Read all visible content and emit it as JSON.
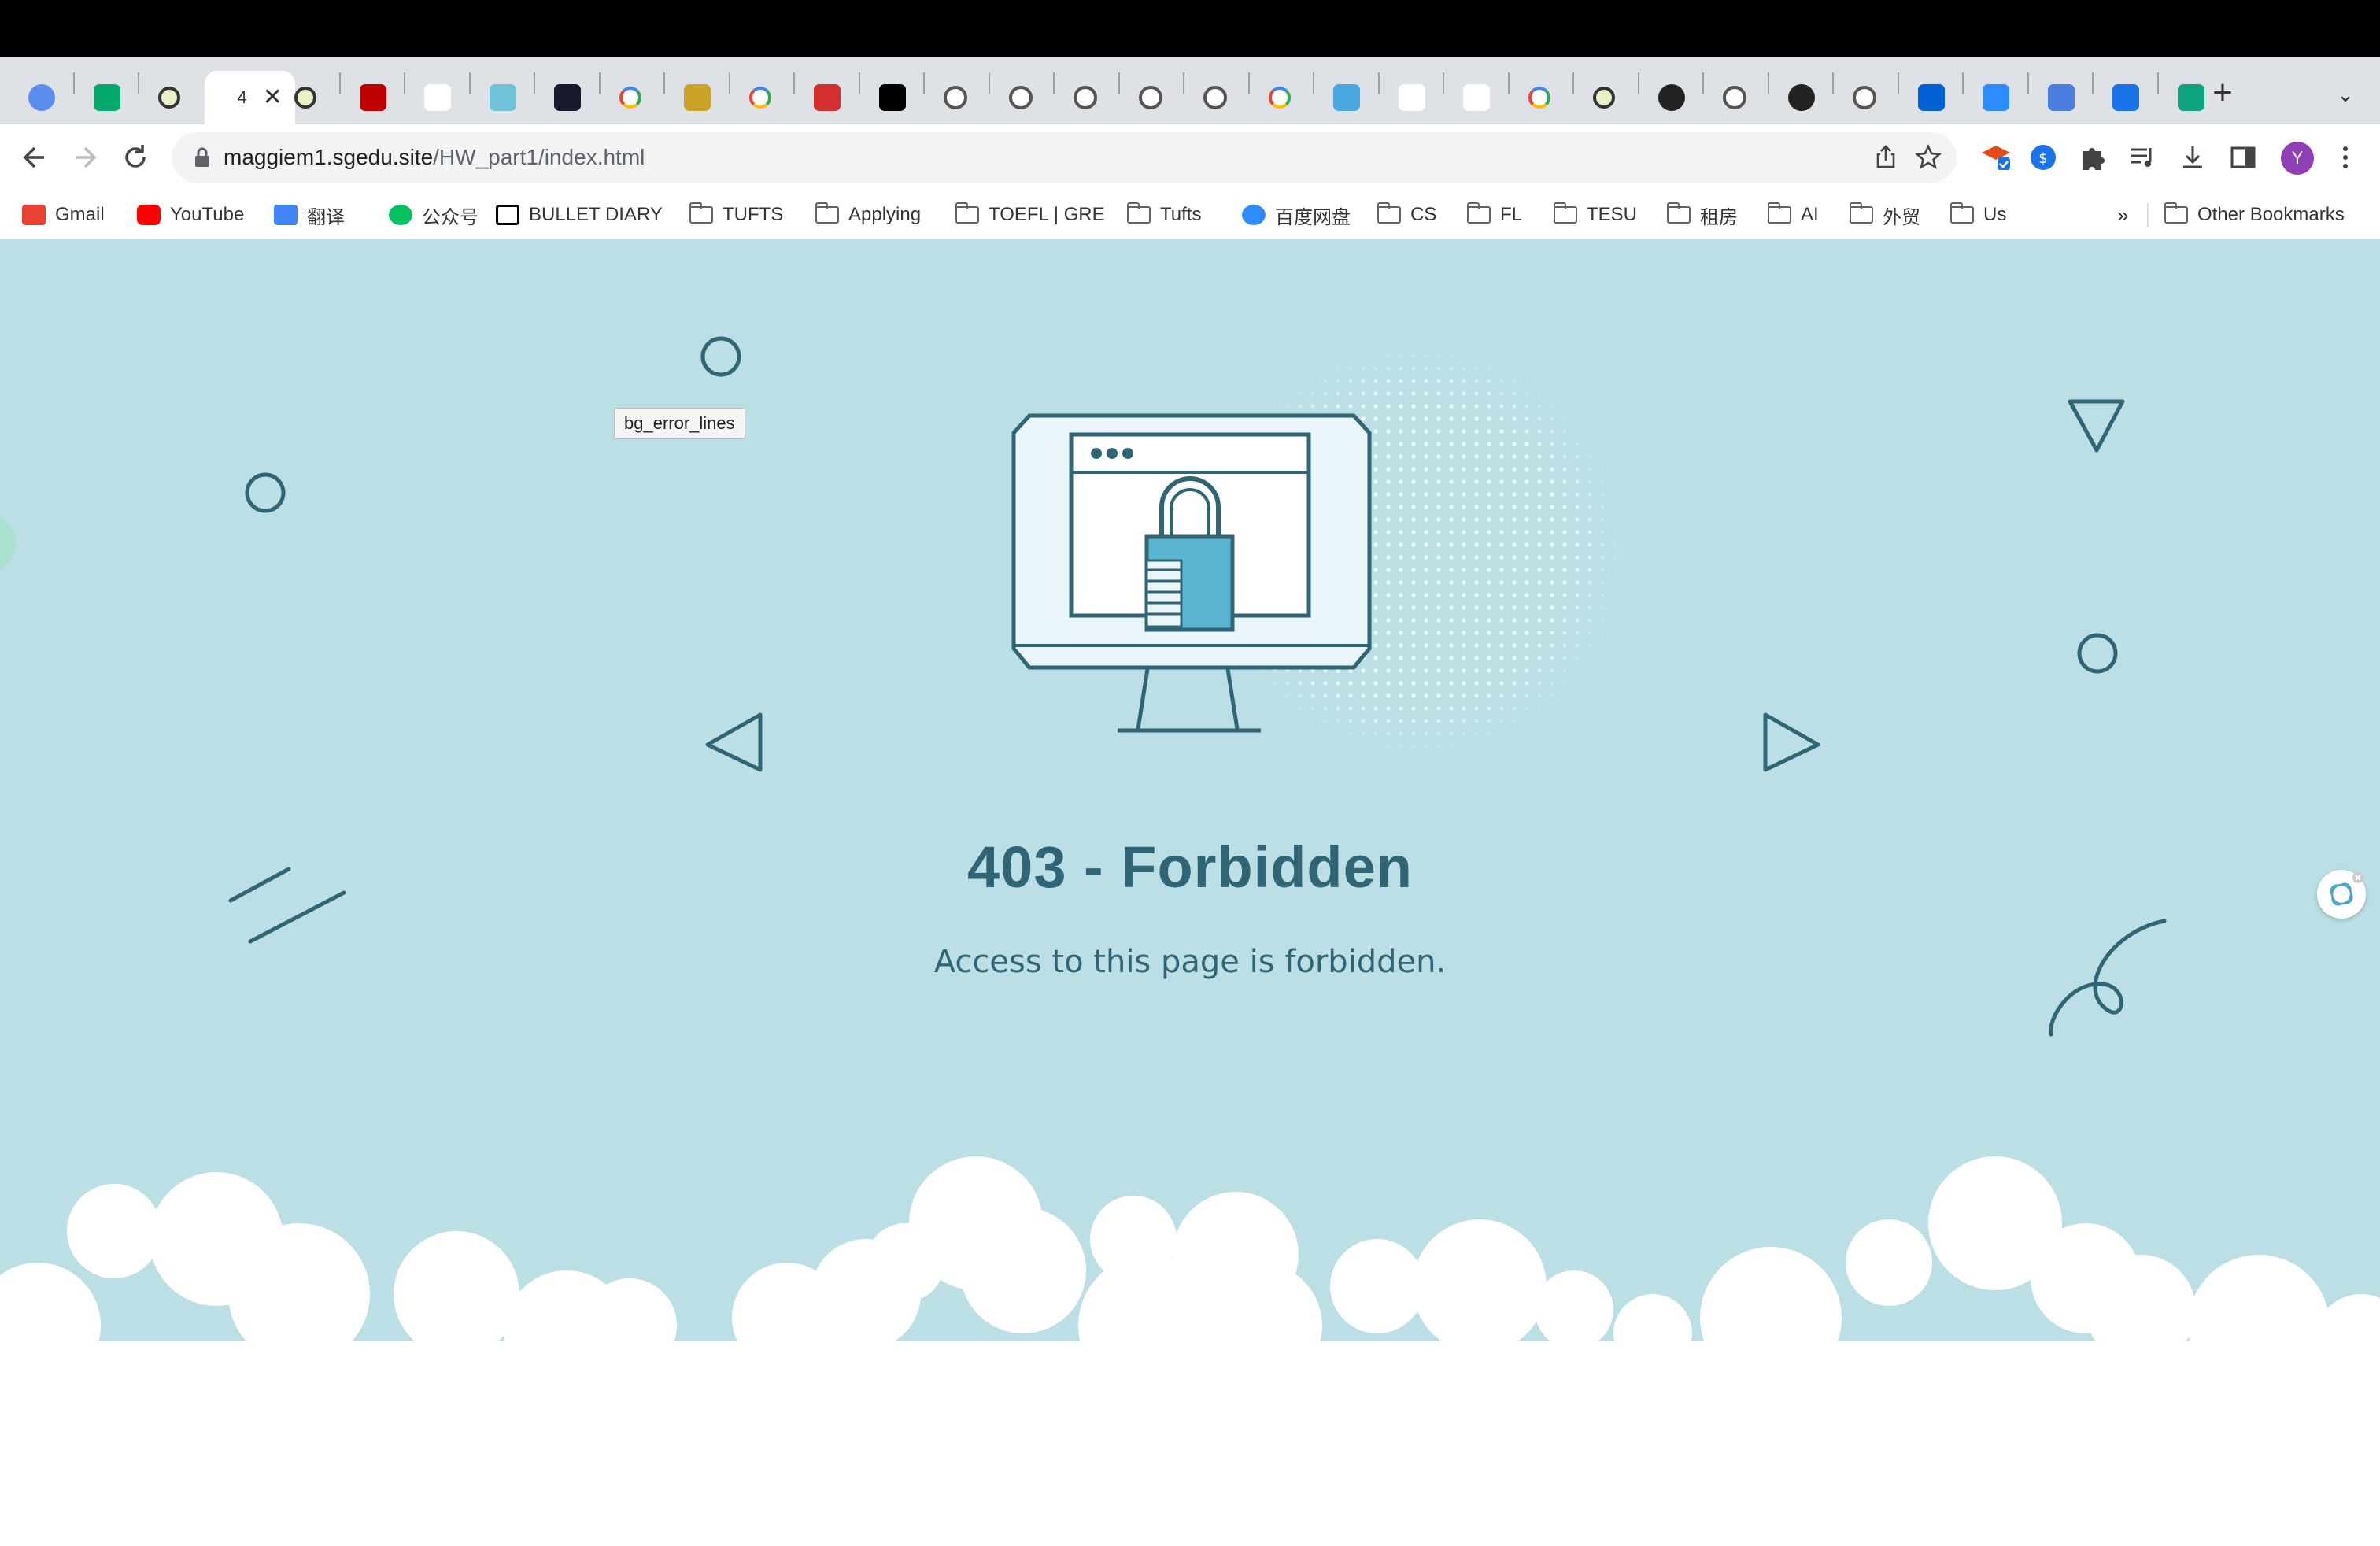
{
  "browser": {
    "tabs": [
      {
        "favicon": "globe-icon",
        "title": "",
        "color": "#5b8def"
      },
      {
        "favicon": "w3-icon",
        "title": "",
        "color": "#04aa6d"
      },
      {
        "favicon": "target-icon",
        "title": "",
        "color": "#e8f0c8"
      },
      {
        "favicon": "page-icon",
        "title": "4",
        "color": "#ffffff",
        "active": true
      },
      {
        "favicon": "target-icon",
        "title": "",
        "color": "#e8f0c8"
      },
      {
        "favicon": "filezilla-icon",
        "title": "",
        "color": "#bf0000"
      },
      {
        "favicon": "gmail-icon",
        "title": "",
        "color": "#ffffff"
      },
      {
        "favicon": "spiral-icon",
        "title": "",
        "color": "#6fc2d8"
      },
      {
        "favicon": "monitor-icon",
        "title": "",
        "color": "#1a1a2e"
      },
      {
        "favicon": "google-icon",
        "title": "",
        "color": "#ffffff"
      },
      {
        "favicon": "crest-icon",
        "title": "",
        "color": "#c9a227"
      },
      {
        "favicon": "google-icon",
        "title": "",
        "color": "#ffffff"
      },
      {
        "favicon": "seal-icon",
        "title": "",
        "color": "#d32f2f"
      },
      {
        "favicon": "unsplash-icon",
        "title": "",
        "color": "#000000"
      },
      {
        "favicon": "globe-gray-icon",
        "title": "",
        "color": "#555555"
      },
      {
        "favicon": "globe-gray-icon",
        "title": "",
        "color": "#555555"
      },
      {
        "favicon": "globe-gray-icon",
        "title": "",
        "color": "#555555"
      },
      {
        "favicon": "globe-gray-icon",
        "title": "",
        "color": "#555555"
      },
      {
        "favicon": "globe-gray-icon",
        "title": "",
        "color": "#555555"
      },
      {
        "favicon": "google-icon",
        "title": "",
        "color": "#ffffff"
      },
      {
        "favicon": "w-circle-icon",
        "title": "",
        "color": "#4aa8e0"
      },
      {
        "favicon": "wikipedia-icon",
        "title": "",
        "color": "#ffffff"
      },
      {
        "favicon": "wikipedia-icon",
        "title": "",
        "color": "#ffffff"
      },
      {
        "favicon": "google-icon",
        "title": "",
        "color": "#ffffff"
      },
      {
        "favicon": "target-icon",
        "title": "",
        "color": "#e8f0c8"
      },
      {
        "favicon": "github-icon",
        "title": "",
        "color": "#ffffff"
      },
      {
        "favicon": "globe-gray-icon",
        "title": "",
        "color": "#555555"
      },
      {
        "favicon": "github-icon",
        "title": "",
        "color": "#ffffff"
      },
      {
        "favicon": "globe-gray-icon",
        "title": "",
        "color": "#555555"
      },
      {
        "favicon": "box-icon",
        "title": "",
        "color": "#0061d5"
      },
      {
        "favicon": "zoom-icon",
        "title": "",
        "color": "#2d8cff"
      },
      {
        "favicon": "bar-chart-icon",
        "title": "",
        "color": "#4a7fe0"
      },
      {
        "favicon": "download-icon",
        "title": "",
        "color": "#1a73e8"
      },
      {
        "favicon": "chatgpt-icon",
        "title": "",
        "color": "#10a37f"
      }
    ],
    "address": {
      "host": "maggiem1.sgedu.site",
      "path": "/HW_part1/index.html"
    },
    "profile_initial": "Y",
    "bookmarks": [
      {
        "label": "Gmail",
        "icon": "gmail-icon"
      },
      {
        "label": "YouTube",
        "icon": "youtube-icon"
      },
      {
        "label": "翻译",
        "icon": "translate-icon"
      },
      {
        "label": "公众号",
        "icon": "wechat-icon"
      },
      {
        "label": "BULLET DIARY",
        "icon": "notion-icon"
      },
      {
        "label": "TUFTS",
        "icon": "folder-icon"
      },
      {
        "label": "Applying",
        "icon": "folder-icon"
      },
      {
        "label": "TOEFL | GRE",
        "icon": "folder-icon"
      },
      {
        "label": "Tufts",
        "icon": "folder-icon"
      },
      {
        "label": "百度网盘",
        "icon": "baidu-cloud-icon"
      },
      {
        "label": "CS",
        "icon": "folder-icon"
      },
      {
        "label": "FL",
        "icon": "folder-icon"
      },
      {
        "label": "TESU",
        "icon": "folder-icon"
      },
      {
        "label": "租房",
        "icon": "folder-icon"
      },
      {
        "label": "AI",
        "icon": "folder-icon"
      },
      {
        "label": "外贸",
        "icon": "folder-icon"
      },
      {
        "label": "Us",
        "icon": "folder-icon"
      }
    ],
    "overflow_label": "»",
    "other_bookmarks": "Other Bookmarks"
  },
  "page": {
    "heading": "403 - Forbidden",
    "message": "Access to this page is forbidden.",
    "tooltip": "bg_error_lines",
    "colors": {
      "background": "#bbdfe5",
      "accent": "#2f6574",
      "lock": "#5ab6d0"
    }
  }
}
